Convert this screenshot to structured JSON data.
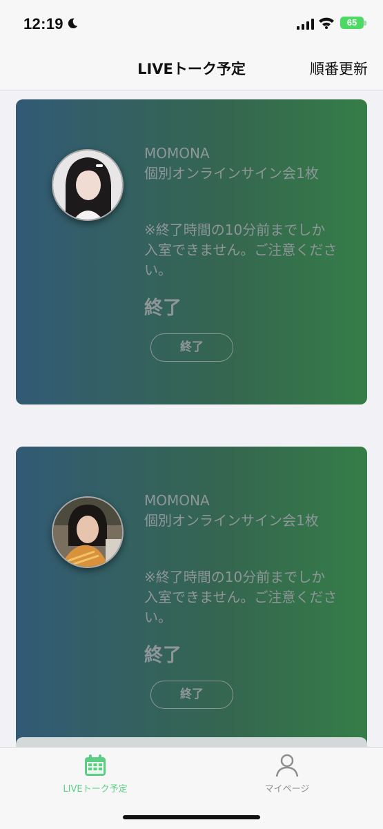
{
  "status_bar": {
    "time": "12:19",
    "battery": "65"
  },
  "nav": {
    "title": "LIVEトーク予定",
    "action": "順番更新"
  },
  "events": [
    {
      "artist": "MOMONA",
      "event": "個別オンラインサイン会1枚",
      "notice": "※終了時間の10分前までしか入室できません。ご注意ください。",
      "status": "終了",
      "button": "終了"
    },
    {
      "artist": "MOMONA",
      "event": "個別オンラインサイン会1枚",
      "notice": "※終了時間の10分前までしか入室できません。ご注意ください。",
      "status": "終了",
      "button": "終了"
    }
  ],
  "tabs": [
    {
      "label": "LIVEトーク予定",
      "icon": "calendar-icon",
      "color": "#5ccf85"
    },
    {
      "label": "マイページ",
      "icon": "person-icon",
      "color": "#8d8d8d"
    }
  ],
  "colors": {
    "card_gradient_start": "#325a75",
    "card_gradient_end": "#357d48",
    "accent": "#5ccf85"
  }
}
